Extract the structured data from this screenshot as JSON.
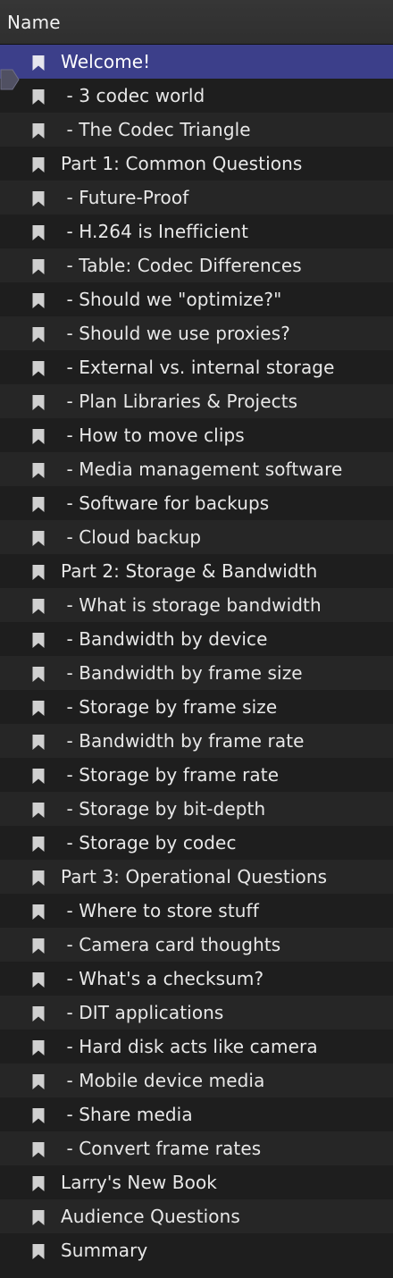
{
  "header": {
    "column_label": "Name"
  },
  "accent": "#3c3f8a",
  "selected_index": 0,
  "items": [
    {
      "label": "Welcome!",
      "icon": "bookmark-icon"
    },
    {
      "label": " - 3 codec world",
      "icon": "bookmark-icon"
    },
    {
      "label": " - The Codec Triangle",
      "icon": "bookmark-icon"
    },
    {
      "label": "Part 1: Common Questions",
      "icon": "bookmark-icon"
    },
    {
      "label": " - Future-Proof",
      "icon": "bookmark-icon"
    },
    {
      "label": " - H.264 is Inefficient",
      "icon": "bookmark-icon"
    },
    {
      "label": " - Table: Codec Differences",
      "icon": "bookmark-icon"
    },
    {
      "label": " - Should we \"optimize?\"",
      "icon": "bookmark-icon"
    },
    {
      "label": " - Should we use proxies?",
      "icon": "bookmark-icon"
    },
    {
      "label": " - External vs. internal storage",
      "icon": "bookmark-icon"
    },
    {
      "label": " - Plan Libraries & Projects",
      "icon": "bookmark-icon"
    },
    {
      "label": " - How to move clips",
      "icon": "bookmark-icon"
    },
    {
      "label": " - Media management software",
      "icon": "bookmark-icon"
    },
    {
      "label": " - Software for backups",
      "icon": "bookmark-icon"
    },
    {
      "label": " - Cloud backup",
      "icon": "bookmark-icon"
    },
    {
      "label": "Part 2: Storage & Bandwidth",
      "icon": "bookmark-icon"
    },
    {
      "label": " - What is storage bandwidth",
      "icon": "bookmark-icon"
    },
    {
      "label": " - Bandwidth by device",
      "icon": "bookmark-icon"
    },
    {
      "label": " - Bandwidth by frame size",
      "icon": "bookmark-icon"
    },
    {
      "label": " - Storage by frame size",
      "icon": "bookmark-icon"
    },
    {
      "label": " - Bandwidth by frame rate",
      "icon": "bookmark-icon"
    },
    {
      "label": " - Storage by frame rate",
      "icon": "bookmark-icon"
    },
    {
      "label": " - Storage by bit-depth",
      "icon": "bookmark-icon"
    },
    {
      "label": " - Storage by codec",
      "icon": "bookmark-icon"
    },
    {
      "label": "Part 3: Operational Questions",
      "icon": "bookmark-icon"
    },
    {
      "label": " - Where to store stuff",
      "icon": "bookmark-icon"
    },
    {
      "label": " - Camera card thoughts",
      "icon": "bookmark-icon"
    },
    {
      "label": " - What's a checksum?",
      "icon": "bookmark-icon"
    },
    {
      "label": " - DIT applications",
      "icon": "bookmark-icon"
    },
    {
      "label": " - Hard disk acts like camera",
      "icon": "bookmark-icon"
    },
    {
      "label": " - Mobile device media",
      "icon": "bookmark-icon"
    },
    {
      "label": " - Share media",
      "icon": "bookmark-icon"
    },
    {
      "label": " - Convert frame rates",
      "icon": "bookmark-icon"
    },
    {
      "label": "Larry's New Book",
      "icon": "bookmark-icon"
    },
    {
      "label": "Audience Questions",
      "icon": "bookmark-icon"
    },
    {
      "label": "Summary",
      "icon": "bookmark-icon"
    }
  ]
}
